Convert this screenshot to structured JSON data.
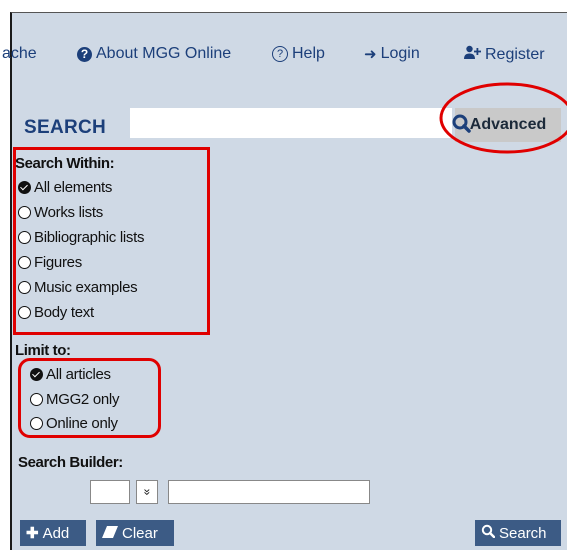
{
  "nav": {
    "cache_label": "ache",
    "about_label": "About MGG Online",
    "help_label": "Help",
    "login_label": "Login",
    "register_label": "Register"
  },
  "search": {
    "label": "SEARCH",
    "placeholder": "",
    "advanced_label": "Advanced"
  },
  "search_within": {
    "title": "Search Within:",
    "options": [
      {
        "label": "All elements",
        "checked": true
      },
      {
        "label": "Works lists",
        "checked": false
      },
      {
        "label": "Bibliographic lists",
        "checked": false
      },
      {
        "label": "Figures",
        "checked": false
      },
      {
        "label": "Music examples",
        "checked": false
      },
      {
        "label": "Body text",
        "checked": false
      }
    ]
  },
  "limit_to": {
    "title": "Limit to:",
    "options": [
      {
        "label": "All articles",
        "checked": true
      },
      {
        "label": "MGG2 only",
        "checked": false
      },
      {
        "label": "Online only",
        "checked": false
      }
    ]
  },
  "search_builder": {
    "title": "Search Builder:",
    "dropdown_glyph": "»"
  },
  "buttons": {
    "add_label": "Add",
    "clear_label": "Clear",
    "search_label": "Search"
  },
  "colors": {
    "background": "#cfd9e5",
    "nav_text": "#1c3f7a",
    "button_bg": "#3c5b85",
    "annotation_red": "#e00000"
  }
}
